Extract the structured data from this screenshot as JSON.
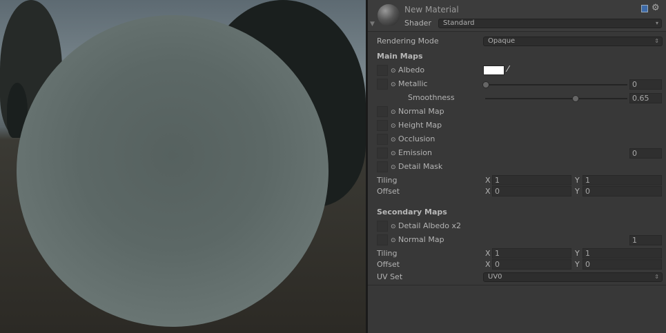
{
  "header": {
    "title": "New Material",
    "shader_label": "Shader",
    "shader_value": "Standard"
  },
  "rendering_mode": {
    "label": "Rendering Mode",
    "value": "Opaque"
  },
  "main_maps": {
    "heading": "Main Maps",
    "albedo": "Albedo",
    "albedo_color": "#ffffff",
    "metallic": "Metallic",
    "metallic_value": "0",
    "metallic_fraction": 0,
    "smoothness": "Smoothness",
    "smoothness_value": "0.65",
    "smoothness_fraction": 0.65,
    "normal_map": "Normal Map",
    "height_map": "Height Map",
    "occlusion": "Occlusion",
    "emission": "Emission",
    "emission_value": "0",
    "detail_mask": "Detail Mask",
    "tiling_label": "Tiling",
    "offset_label": "Offset",
    "tiling_x": "1",
    "tiling_y": "1",
    "offset_x": "0",
    "offset_y": "0"
  },
  "secondary_maps": {
    "heading": "Secondary Maps",
    "detail_albedo": "Detail Albedo x2",
    "normal_map": "Normal Map",
    "normal_value": "1",
    "tiling_label": "Tiling",
    "offset_label": "Offset",
    "tiling_x": "1",
    "tiling_y": "1",
    "offset_x": "0",
    "offset_y": "0",
    "uv_label": "UV Set",
    "uv_value": "UV0"
  },
  "axis": {
    "x": "X",
    "y": "Y"
  },
  "icons": {
    "circle": "⊙"
  }
}
